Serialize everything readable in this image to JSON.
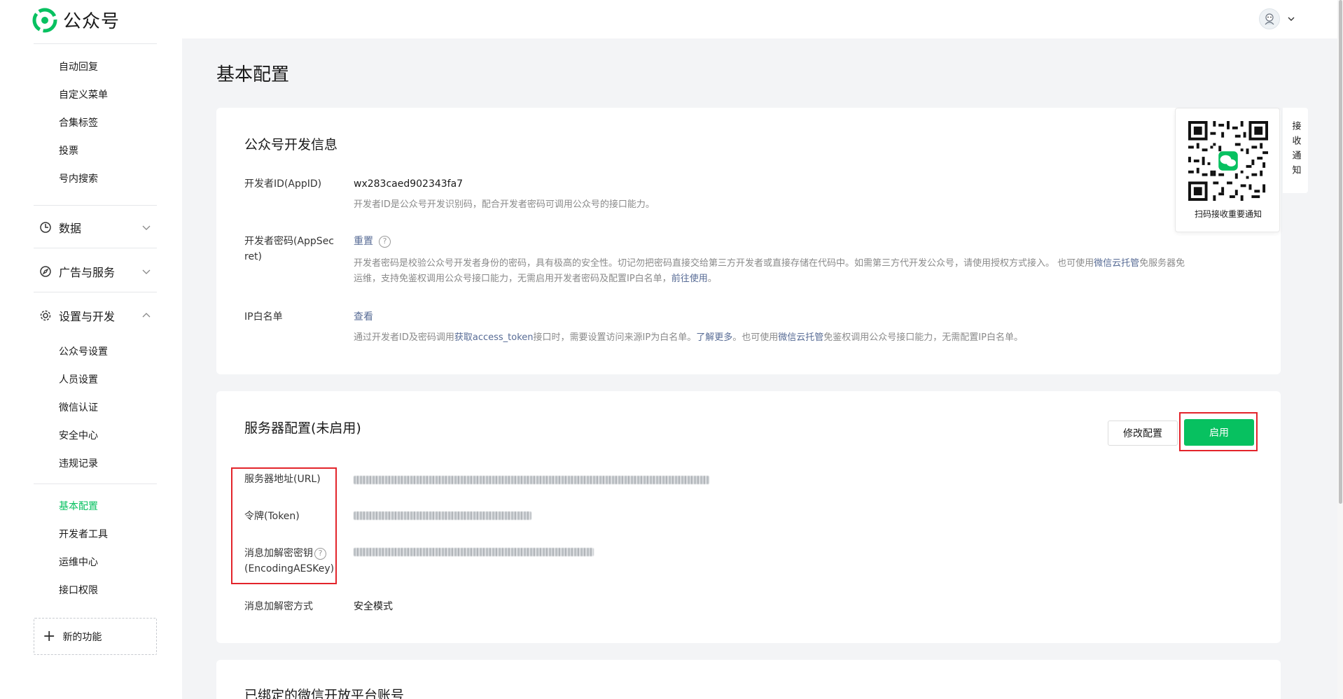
{
  "header": {
    "logo_text": "公众号"
  },
  "sidebar": {
    "top_items": [
      "自动回复",
      "自定义菜单",
      "合集标签",
      "投票",
      "号内搜索"
    ],
    "groups": {
      "data": "数据",
      "ads": "广告与服务",
      "settings": "设置与开发"
    },
    "settings_items": [
      "公众号设置",
      "人员设置",
      "微信认证",
      "安全中心",
      "违规记录"
    ],
    "dev_items": [
      "基本配置",
      "开发者工具",
      "运维中心",
      "接口权限"
    ],
    "active_item": "基本配置",
    "new_feature": "新的功能"
  },
  "page": {
    "title": "基本配置"
  },
  "dev_info": {
    "title": "公众号开发信息",
    "appid_label": "开发者ID(AppID)",
    "appid_value": "wx283caed902343fa7",
    "appid_desc": "开发者ID是公众号开发识别码，配合开发者密码可调用公众号的接口能力。",
    "secret_label_1": "开发者密码(AppSec",
    "secret_label_2": "ret)",
    "secret_reset": "重置",
    "secret_desc_1a": "开发者密码是校验公众号开发者身份的密码，具有极高的安全性。切记勿把密码直接交给第三方开发者或直接存储在代码中。如需第三方代开发公众号，请使用授权方式接入。 也可使用",
    "secret_desc_link": "微信云托管",
    "secret_desc_1b": "免服务器免",
    "secret_desc_2a": "运维，支持免鉴权调用公众号接口能力，无需启用开发者密码及配置IP白名单，",
    "secret_desc_2_link": "前往使用",
    "secret_desc_2b": "。",
    "ip_label": "IP白名单",
    "ip_view": "查看",
    "ip_desc_a": "通过开发者ID及密码调用",
    "ip_desc_link1": "获取access_token",
    "ip_desc_b": "接口时，需要设置访问来源IP为白名单。",
    "ip_desc_link2": "了解更多",
    "ip_desc_c": "。也可使用",
    "ip_desc_link3": "微信云托管",
    "ip_desc_d": "免鉴权调用公众号接口能力，无需配置IP白名单。"
  },
  "server_config": {
    "title": "服务器配置(未启用)",
    "edit_button": "修改配置",
    "enable_button": "启用",
    "url_label": "服务器地址(URL)",
    "token_label": "令牌(Token)",
    "aes_label_1": "消息加解密密钥",
    "aes_label_2": "(EncodingAESKey)",
    "mode_label": "消息加解密方式",
    "mode_value": "安全模式"
  },
  "bound_accounts": {
    "title": "已绑定的微信开放平台账号"
  },
  "qr_widget": {
    "caption": "扫码接收重要通知",
    "tab_label": "接收通知"
  },
  "colors": {
    "brand_green": "#07c160",
    "link": "#576b95",
    "highlight_red": "#e3242b"
  }
}
